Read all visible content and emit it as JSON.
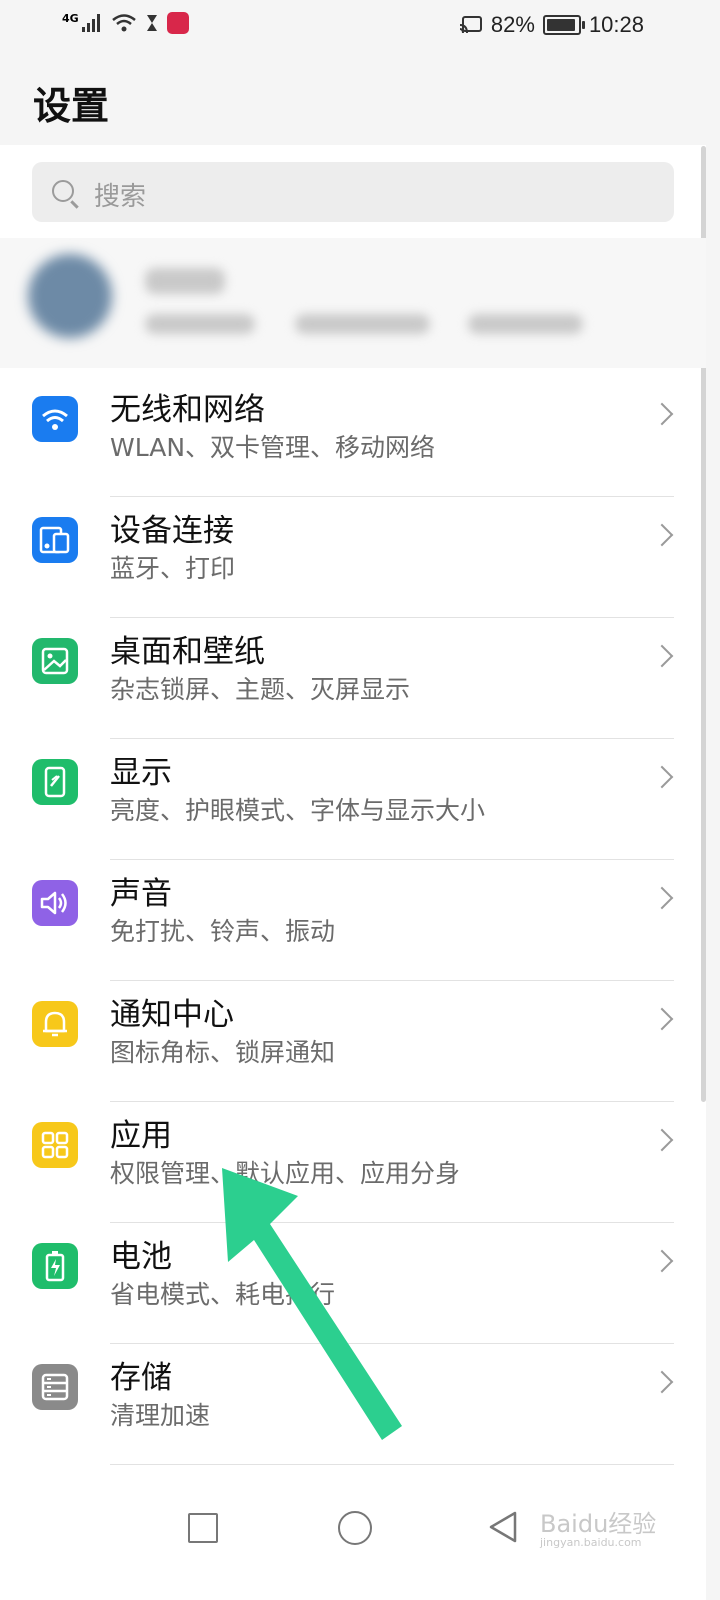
{
  "status_bar": {
    "network": "4G",
    "battery": "82%",
    "battery_level": 0.82,
    "time": "10:28"
  },
  "page_title": "设置",
  "search": {
    "placeholder": "搜索"
  },
  "settings_items": [
    {
      "title": "无线和网络",
      "subtitle": "WLAN、双卡管理、移动网络",
      "icon": "wifi-icon",
      "color": "#1a7cf0"
    },
    {
      "title": "设备连接",
      "subtitle": "蓝牙、打印",
      "icon": "device-connection-icon",
      "color": "#1a7cf0"
    },
    {
      "title": "桌面和壁纸",
      "subtitle": "杂志锁屏、主题、灭屏显示",
      "icon": "wallpaper-icon",
      "color": "#22b86d"
    },
    {
      "title": "显示",
      "subtitle": "亮度、护眼模式、字体与显示大小",
      "icon": "display-icon",
      "color": "#1fbd6b"
    },
    {
      "title": "声音",
      "subtitle": "免打扰、铃声、振动",
      "icon": "sound-icon",
      "color": "#8f62e6"
    },
    {
      "title": "通知中心",
      "subtitle": "图标角标、锁屏通知",
      "icon": "notification-bell-icon",
      "color": "#f7c81a"
    },
    {
      "title": "应用",
      "subtitle": "权限管理、默认应用、应用分身",
      "icon": "apps-grid-icon",
      "color": "#f7c81a"
    },
    {
      "title": "电池",
      "subtitle": "省电模式、耗电排行",
      "icon": "battery-icon",
      "color": "#1fbd6b"
    },
    {
      "title": "存储",
      "subtitle": "清理加速",
      "icon": "storage-icon",
      "color": "#8a8a8a"
    }
  ],
  "annotation": {
    "color": "#2ccf8f"
  },
  "watermark": {
    "text": "Baidu经验",
    "sub": "jingyan.baidu.com"
  }
}
